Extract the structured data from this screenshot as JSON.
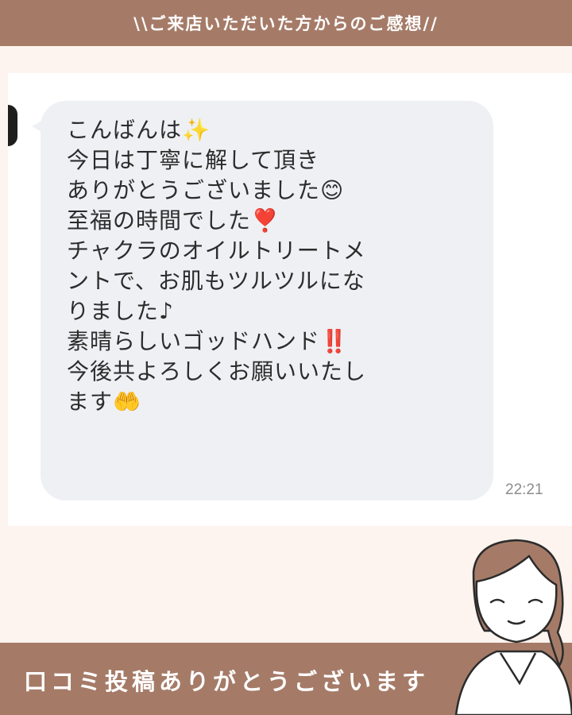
{
  "header": {
    "title": "\\\\ご来店いただいた方からのご感想//"
  },
  "message": {
    "lines": [
      "こんばんは✨",
      "今日は丁寧に解して頂き",
      "ありがとうございました😊",
      "至福の時間でした❣️",
      "チャクラのオイルトリートメ",
      "ントで、お肌もツルツルにな",
      "りました♪",
      "素晴らしいゴッドハンド‼️",
      "今後共よろしくお願いいたし",
      "ます🤲"
    ],
    "timestamp": "22:21"
  },
  "footer": {
    "caption": "口コミ投稿ありがとうございます"
  },
  "colors": {
    "banner": "#a57b68",
    "page_background": "#fdf4ef",
    "bubble": "#eef0f3",
    "text": "#2c2c2c",
    "timestamp": "#8d8d8d"
  },
  "icons": [
    "avatar",
    "sparkles-emoji",
    "smiling-face-emoji",
    "heart-exclamation-emoji",
    "double-exclamation-emoji",
    "palms-up-emoji",
    "woman-illustration"
  ]
}
